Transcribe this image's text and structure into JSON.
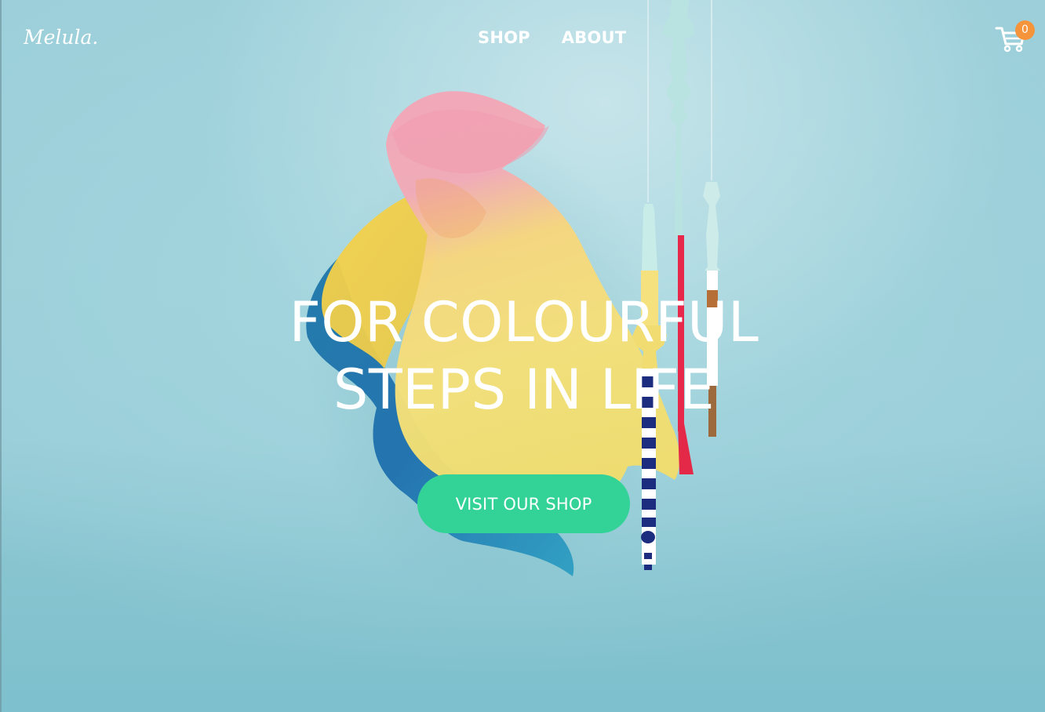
{
  "brand": {
    "logo_text": "Melula."
  },
  "nav": {
    "items": [
      {
        "label": "SHOP"
      },
      {
        "label": "ABOUT"
      }
    ]
  },
  "cart": {
    "count": "0",
    "icon": "shopping-cart-icon",
    "badge_color": "#f5943b"
  },
  "hero": {
    "headline_line1": "FOR COLOURFUL",
    "headline_line2": "STEPS IN LIFE",
    "cta_label": "VISIT OUR SHOP",
    "cta_color": "#33d398",
    "background_color": "#9ccfd9"
  }
}
